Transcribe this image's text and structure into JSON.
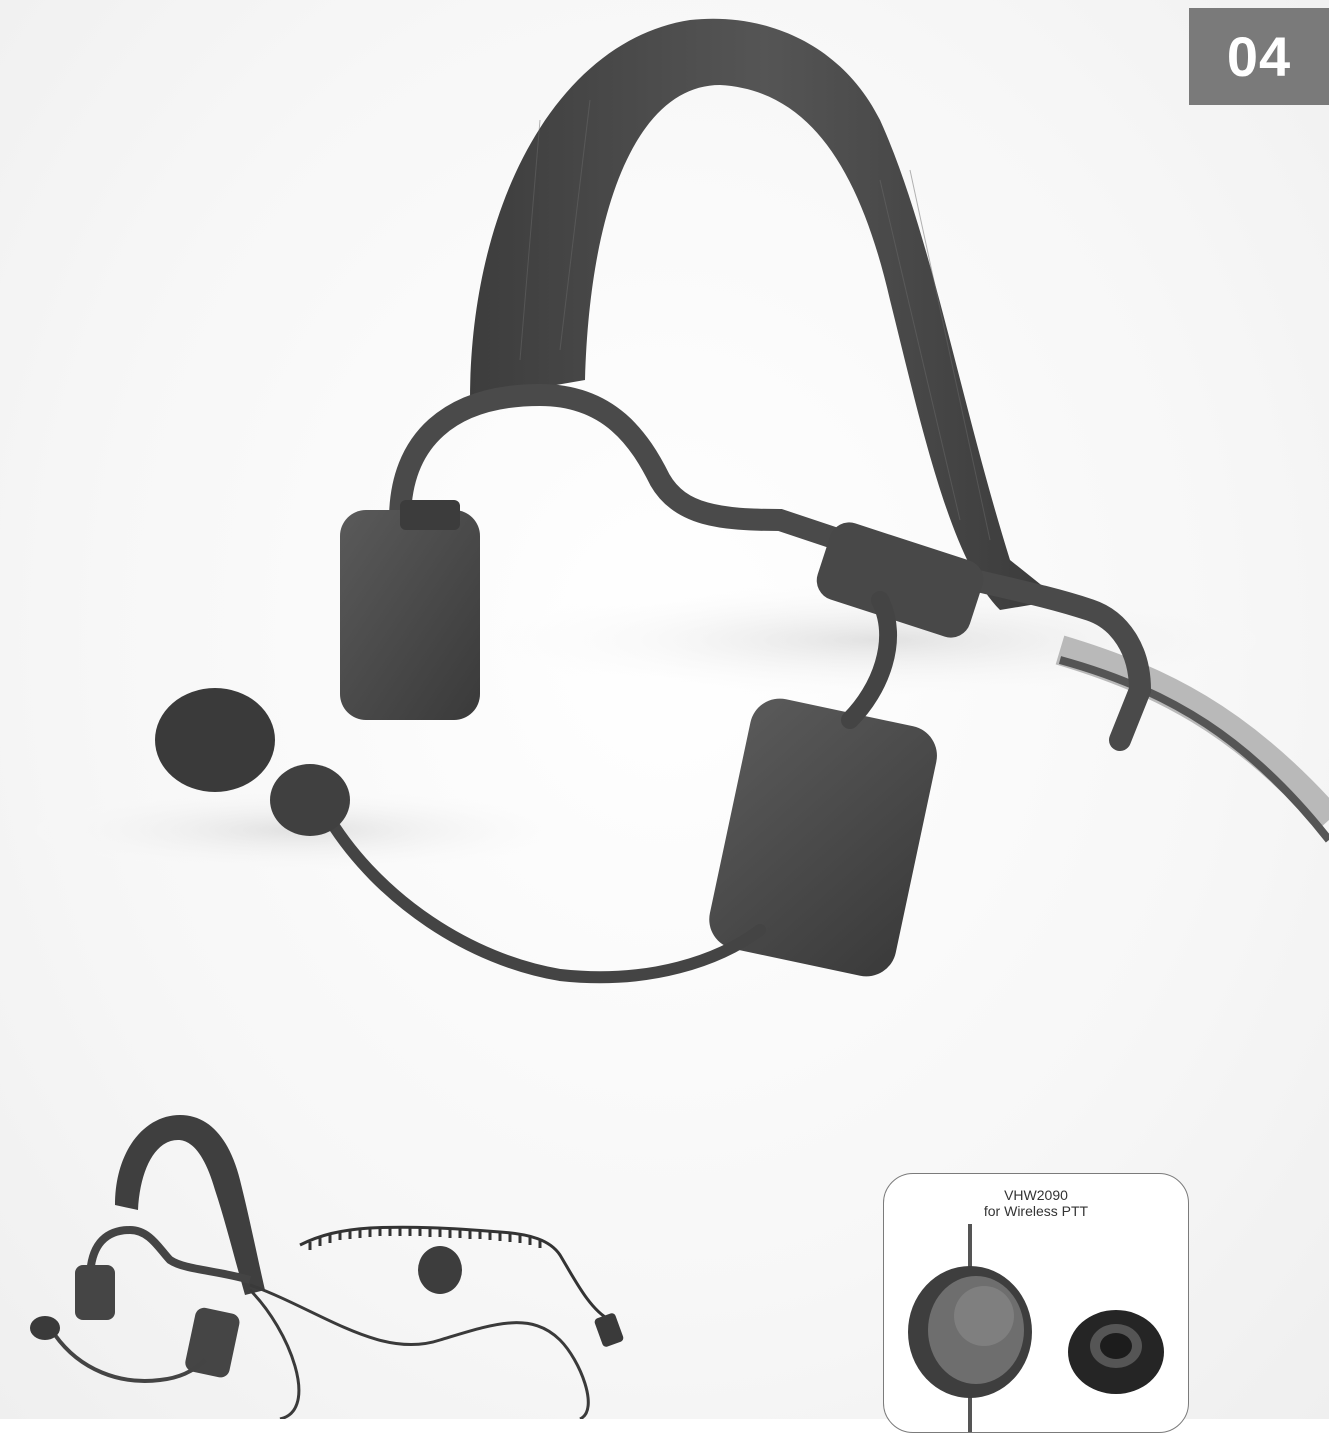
{
  "page_number": "04",
  "main_image": {
    "subject": "headset-with-boom-microphone"
  },
  "thumbnail_image": {
    "subject": "headset-with-coiled-cable"
  },
  "inset": {
    "model": "VHW2090",
    "caption": "for Wireless PTT",
    "subject": "push-to-talk-button-and-ring-adapter"
  },
  "colors": {
    "badge_background": "#7a7a7a",
    "badge_text": "#ffffff",
    "product": "#4a4a4a",
    "inset_border": "#7b7b7b"
  }
}
